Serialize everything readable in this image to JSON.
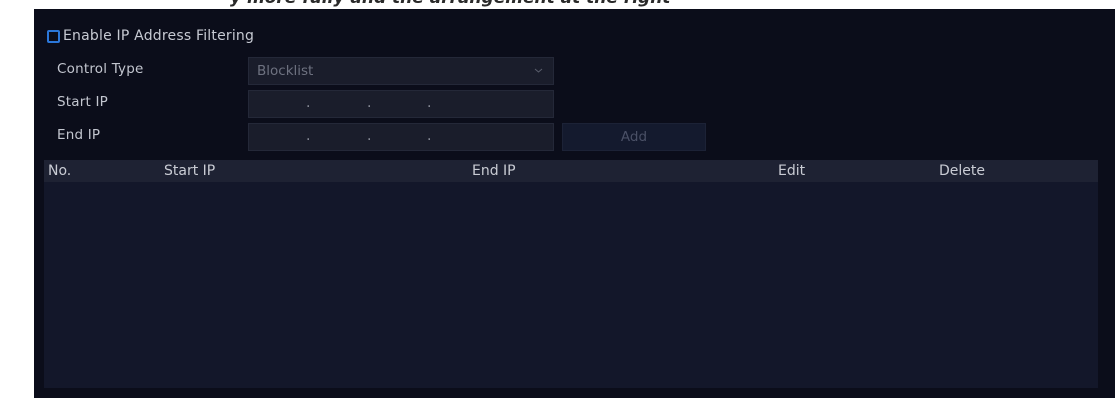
{
  "top_strip": {
    "partial_text": "y more fully and the arrangement at the right"
  },
  "filter": {
    "enable_label": "Enable IP Address Filtering",
    "enabled": false
  },
  "form": {
    "control_type_label": "Control Type",
    "control_type_value": "Blocklist",
    "start_ip_label": "Start IP",
    "start_ip_value": "",
    "end_ip_label": "End IP",
    "end_ip_value": "",
    "add_label": "Add",
    "ip_separator": "."
  },
  "table": {
    "columns": [
      "No.",
      "Start IP",
      "End IP",
      "Edit",
      "Delete"
    ],
    "rows": []
  },
  "colors": {
    "panel_bg": "#0b0d1a",
    "accent": "#2b77d9",
    "field_bg": "#1a1d2b",
    "table_bg": "#13172a",
    "table_header_bg": "#1e2233"
  }
}
